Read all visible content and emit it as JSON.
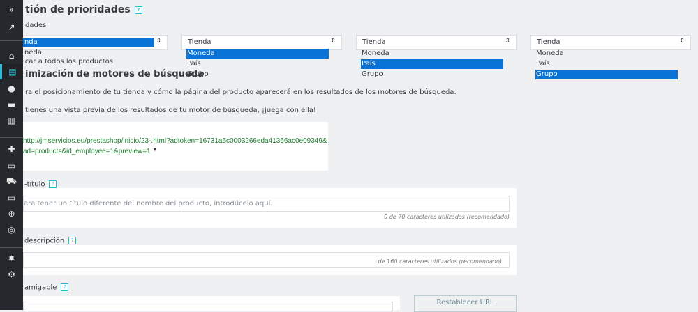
{
  "sidebar": {
    "items": [
      {
        "icon": "expand-icon",
        "glyph": "»"
      },
      {
        "icon": "trending-up-icon",
        "glyph": "↗"
      },
      {
        "icon": "basket-icon",
        "glyph": "⌂"
      },
      {
        "icon": "store-icon",
        "glyph": "▤"
      },
      {
        "icon": "user-icon",
        "glyph": "●"
      },
      {
        "icon": "chat-icon",
        "glyph": "▬"
      },
      {
        "icon": "stats-icon",
        "glyph": "▥"
      },
      {
        "icon": "puzzle-icon",
        "glyph": "✚"
      },
      {
        "icon": "monitor-icon",
        "glyph": "▭"
      },
      {
        "icon": "truck-icon",
        "glyph": "⛟"
      },
      {
        "icon": "credit-card-icon",
        "glyph": "▭"
      },
      {
        "icon": "globe-icon",
        "glyph": "⊕"
      },
      {
        "icon": "radar-icon",
        "glyph": "◎"
      },
      {
        "icon": "gear-icon",
        "glyph": "✹"
      },
      {
        "icon": "settings-box-icon",
        "glyph": "⚙"
      }
    ]
  },
  "priorities": {
    "title": "tión de prioridades",
    "label": "dades",
    "col1": {
      "selected": "nda",
      "opt1": "neda",
      "apply": "icar a todos los productos"
    },
    "columns": [
      {
        "value": "Tienda",
        "options": [
          "Moneda",
          "País",
          "Grupo"
        ],
        "selected": 0
      },
      {
        "value": "Tienda",
        "options": [
          "Moneda",
          "País",
          "Grupo"
        ],
        "selected": 1
      },
      {
        "value": "Tienda",
        "options": [
          "Moneda",
          "País",
          "Grupo"
        ],
        "selected": 2
      }
    ]
  },
  "seo": {
    "title": "imización de motores de búsqueda",
    "desc1": "ra el posicionamiento de tu tienda y cómo la página del producto aparecerá en los resultados de los motores de búsqueda.",
    "desc2": "tienes una vista previa de los resultados de tu motor de búsqueda, ¡juega con ella!",
    "preview_url1": "http://jmservicios.eu/prestashop/inicio/23-.html?adtoken=16731a6c0003266eda41366ac0e09349&",
    "preview_url2": "ad=products&id_employee=1&preview=1",
    "meta_title_label": "-título",
    "meta_title_placeholder": "ara tener un título diferente del nombre del producto, introdúcelo aquí.",
    "meta_title_counter": "0 de 70 caracteres utilizados (recomendado)",
    "meta_desc_label": "descripción",
    "meta_desc_counter": "de 160 caracteres utilizados (recomendado)",
    "friendly_url_label": "amigable",
    "reset_url_button": "Restablecer URL",
    "help": "?"
  }
}
